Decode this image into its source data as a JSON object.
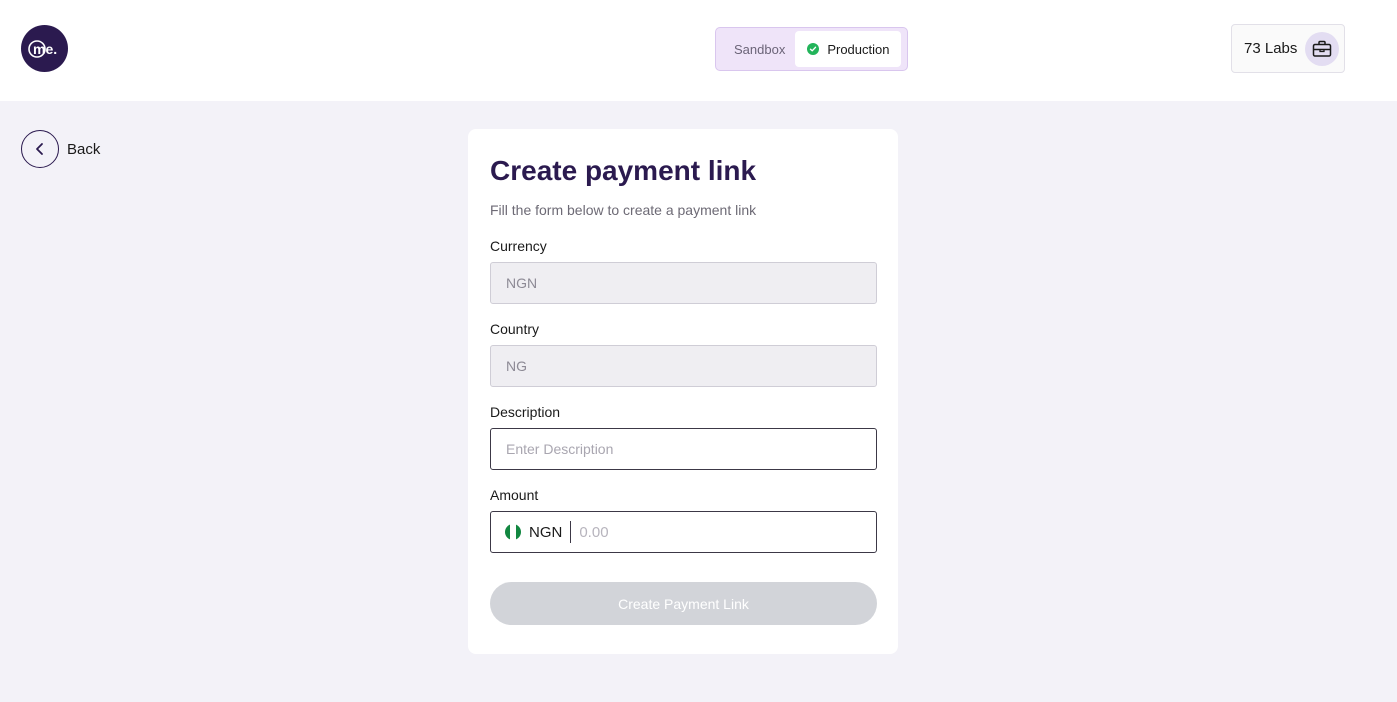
{
  "brand": {
    "logo_text": "me."
  },
  "environment": {
    "sandbox_label": "Sandbox",
    "production_label": "Production",
    "active": "Production",
    "active_color": "#22b45a"
  },
  "organization": {
    "name": "73 Labs",
    "icon": "briefcase-icon"
  },
  "nav": {
    "back_label": "Back"
  },
  "form": {
    "title": "Create payment link",
    "subtitle": "Fill the form below to create a payment link",
    "currency": {
      "label": "Currency",
      "value": "NGN"
    },
    "country": {
      "label": "Country",
      "value": "NG"
    },
    "description": {
      "label": "Description",
      "placeholder": "Enter Description",
      "value": ""
    },
    "amount": {
      "label": "Amount",
      "currency_code": "NGN",
      "flag": "nigeria-flag-icon",
      "placeholder": "0.00",
      "value": ""
    },
    "submit_label": "Create Payment Link"
  },
  "colors": {
    "brand_dark": "#2b1a4f",
    "background": "#f3f2f8",
    "button_disabled": "#d2d4d9"
  }
}
